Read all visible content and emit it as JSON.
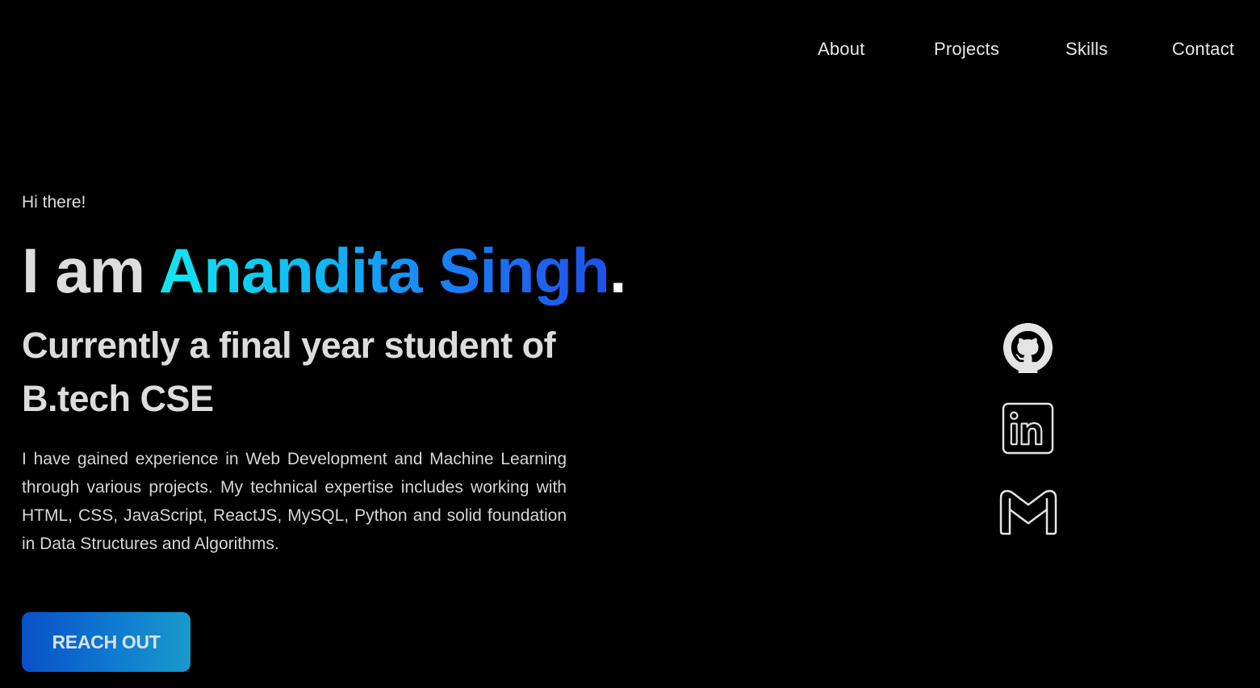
{
  "nav": {
    "items": [
      {
        "label": "About"
      },
      {
        "label": "Projects"
      },
      {
        "label": "Skills"
      },
      {
        "label": "Contact"
      }
    ]
  },
  "hero": {
    "greeting": "Hi there!",
    "headline_lead": "I am ",
    "name": "Anandita Singh",
    "headline_end": ".",
    "subheading": "Currently a final year student of B.tech CSE",
    "bio": "I have gained experience in Web Development and Machine Learning through various projects. My technical expertise includes working with HTML, CSS, JavaScript, ReactJS, MySQL, Python and solid foundation in Data Structures and Algorithms.",
    "cta_label": "REACH OUT"
  },
  "social": {
    "items": [
      {
        "icon": "github-icon"
      },
      {
        "icon": "linkedin-icon"
      },
      {
        "icon": "gmail-icon"
      }
    ]
  },
  "colors": {
    "background": "#000000",
    "name_gradient_start": "#14e6f0",
    "name_gradient_end": "#1e4fe8",
    "cta_gradient_start": "#0a50c8",
    "cta_gradient_end": "#1a9ac9"
  }
}
